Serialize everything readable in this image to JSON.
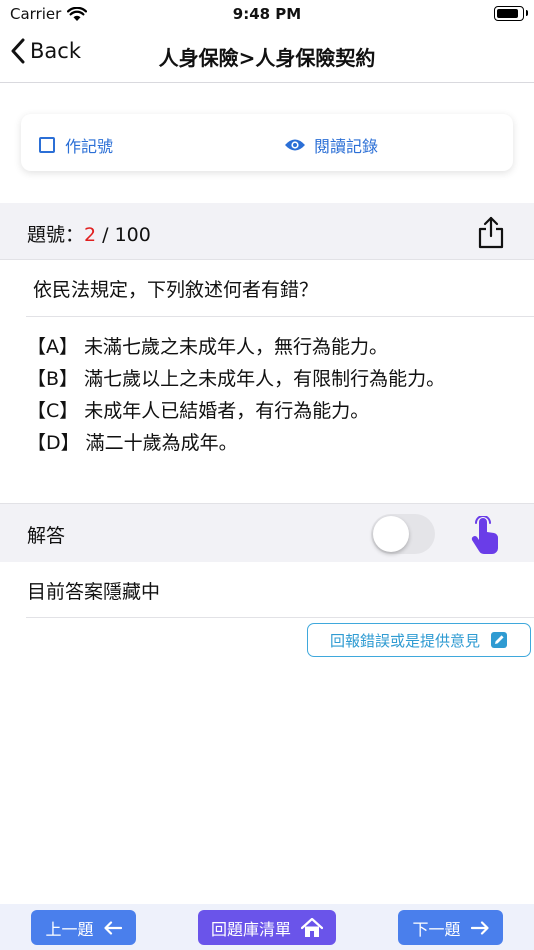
{
  "status": {
    "carrier": "Carrier",
    "time": "9:48 PM",
    "battery_level": 0.95
  },
  "nav": {
    "back_label": "Back",
    "title": "人身保險>人身保險契約"
  },
  "toolbar": {
    "mark_label": "作記號",
    "history_label": "閱讀記錄"
  },
  "question": {
    "number_prefix": "題號：",
    "current": "2",
    "total": "/ 100",
    "text": "依民法規定，下列敘述何者有錯？",
    "options": [
      "【A】 未滿七歲之未成年人，無行為能力。",
      "【B】 滿七歲以上之未成年人，有限制行為能力。",
      "【C】 未成年人已結婚者，有行為能力。",
      "【D】 滿二十歲為成年。"
    ]
  },
  "answer": {
    "label": "解答",
    "toggle_on": false,
    "hidden_text": "目前答案隱藏中"
  },
  "feedback": {
    "label": "回報錯誤或是提供意見"
  },
  "bottom": {
    "prev_label": "上一題",
    "list_label": "回題庫清單",
    "next_label": "下一題"
  },
  "colors": {
    "accent_blue": "#2b6fd6",
    "nav_button": "#4a7fec",
    "list_button": "#6a54ea",
    "current_number": "#e02020",
    "tap_icon": "#6a3de8"
  }
}
